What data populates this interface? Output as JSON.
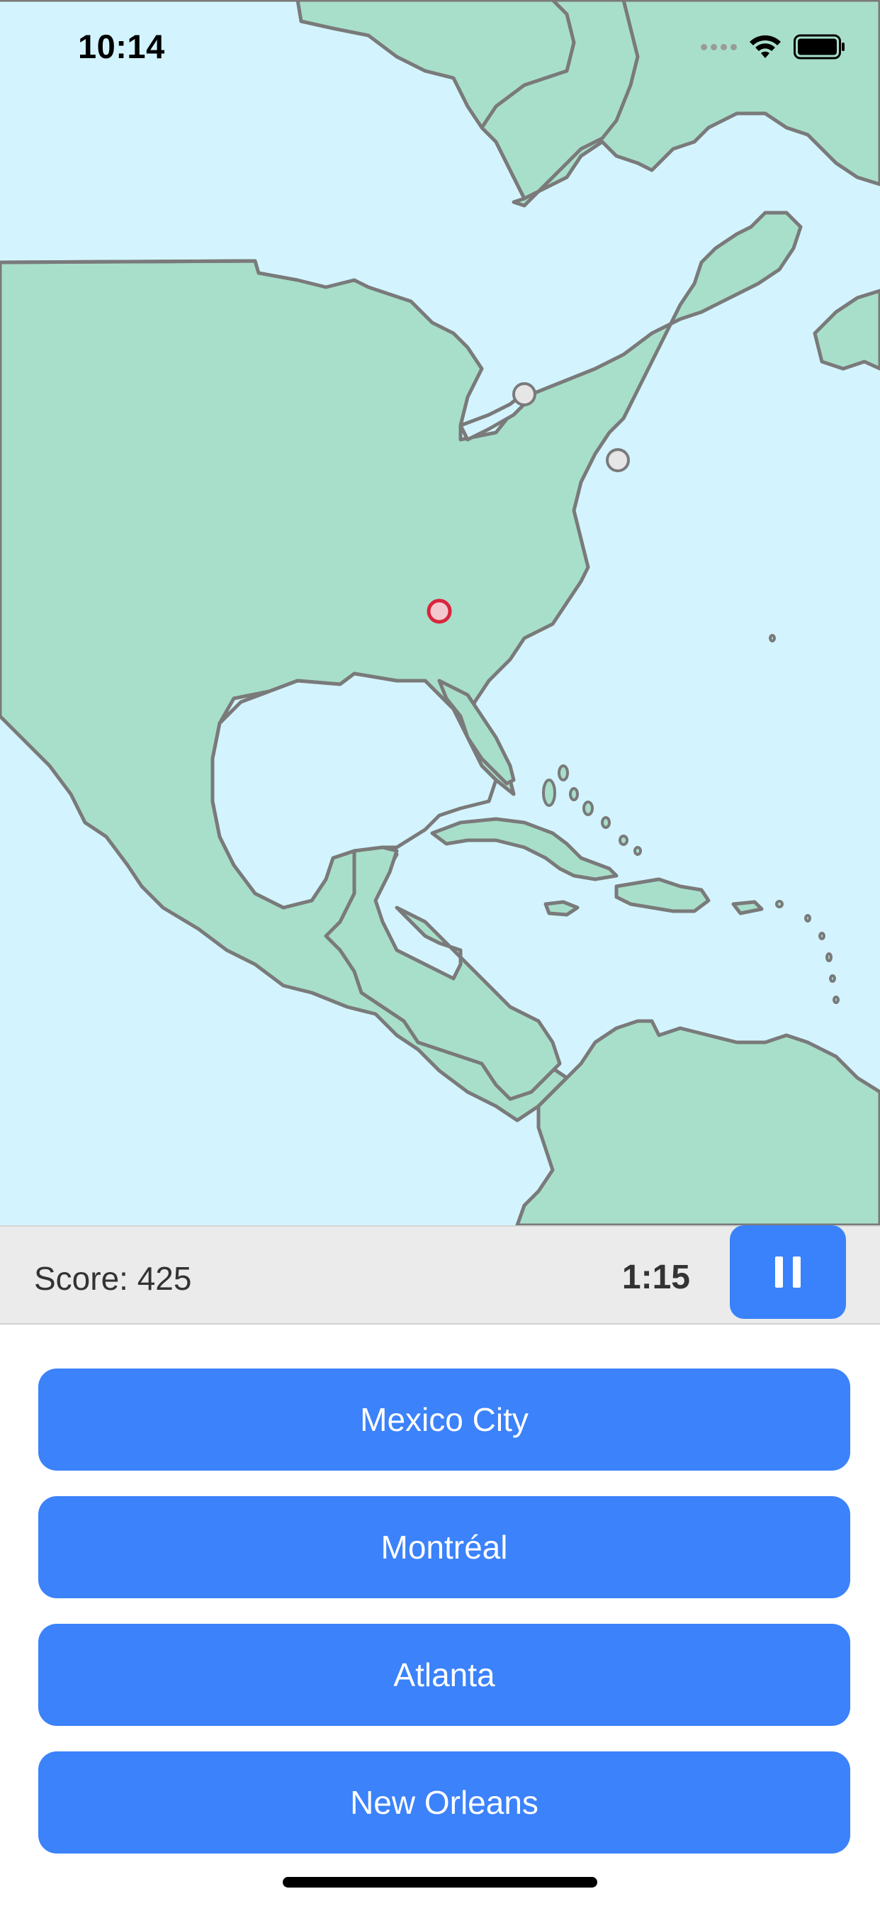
{
  "status_bar": {
    "time": "10:14",
    "icons": [
      "signal-icon",
      "wifi-icon",
      "battery-icon"
    ]
  },
  "map": {
    "colors": {
      "ocean": "#d3f4fe",
      "land": "#a8dfcb",
      "border": "#7a7a7a",
      "target_marker": "#d7263d",
      "city_marker": "#e6e6e6"
    }
  },
  "info_bar": {
    "score_label": "Score: 425",
    "timer": "1:15",
    "pause_icon": "pause-icon"
  },
  "answers": [
    {
      "label": "Mexico City"
    },
    {
      "label": "Montréal"
    },
    {
      "label": "Atlanta"
    },
    {
      "label": "New Orleans"
    }
  ],
  "colors": {
    "accent": "#3b82fb",
    "info_bar_bg": "#ebebeb"
  }
}
